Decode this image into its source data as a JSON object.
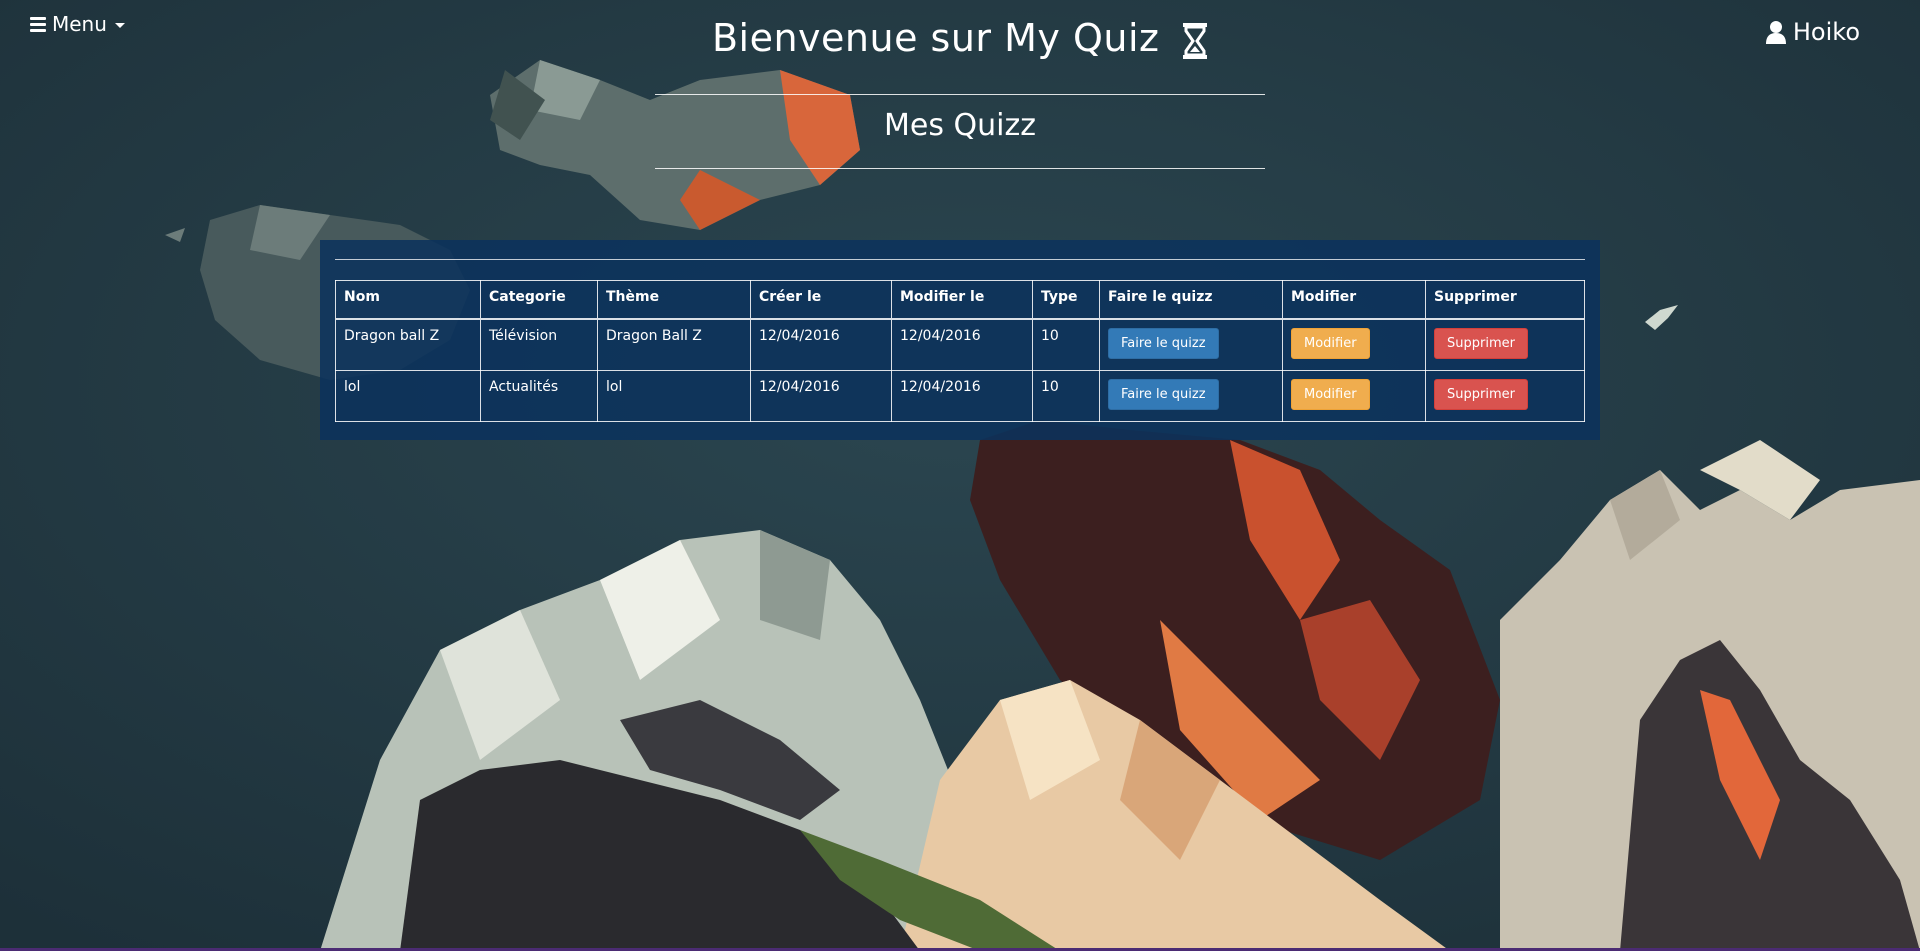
{
  "header": {
    "menu_label": "Menu",
    "title": "Bienvenue sur My Quiz",
    "user_name": "Hoiko"
  },
  "section": {
    "title": "Mes Quizz"
  },
  "table": {
    "columns": [
      "Nom",
      "Categorie",
      "Thème",
      "Créer le",
      "Modifier le",
      "Type",
      "Faire le quizz",
      "Modifier",
      "Supprimer"
    ],
    "rows": [
      {
        "nom": "Dragon ball Z",
        "categorie": "Télévision",
        "theme": "Dragon Ball Z",
        "cree_le": "12/04/2016",
        "modifie_le": "12/04/2016",
        "type": "10",
        "play_label": "Faire le quizz",
        "edit_label": "Modifier",
        "delete_label": "Supprimer"
      },
      {
        "nom": "lol",
        "categorie": "Actualités",
        "theme": "lol",
        "cree_le": "12/04/2016",
        "modifie_le": "12/04/2016",
        "type": "10",
        "play_label": "Faire le quizz",
        "edit_label": "Modifier",
        "delete_label": "Supprimer"
      }
    ]
  },
  "colors": {
    "background": "#233a44",
    "panel": "#0b325c",
    "btn_primary": "#337ab7",
    "btn_warning": "#f0ad4e",
    "btn_danger": "#d9534f"
  },
  "icons": {
    "menu": "hamburger-icon",
    "title": "hourglass-icon",
    "user": "user-icon"
  }
}
